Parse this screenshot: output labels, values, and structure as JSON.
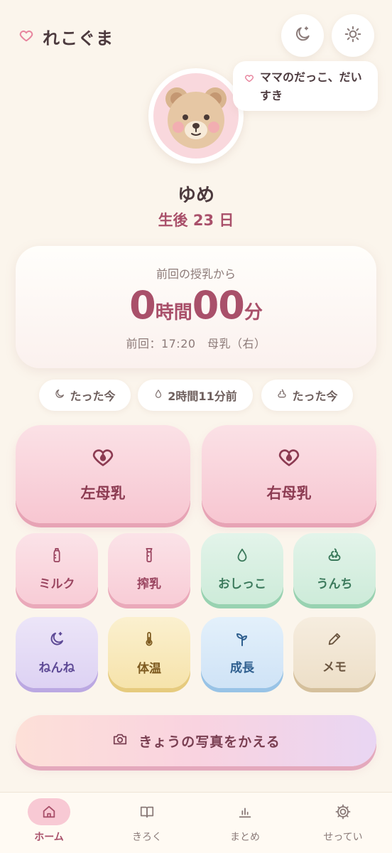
{
  "header": {
    "app_title": "れこぐま",
    "colors": {
      "brand": "#a9506a",
      "background": "#fbf5ec"
    }
  },
  "bubble": {
    "text": "ママのだっこ、だいすき"
  },
  "baby": {
    "name": "ゆめ",
    "age": "生後 23 日"
  },
  "timer": {
    "label": "前回の授乳から",
    "hours": "0",
    "hours_unit": "時間",
    "minutes": "00",
    "minutes_unit": "分",
    "last": "前回：17:20　母乳（右）"
  },
  "chips": [
    {
      "icon": "moon-icon",
      "label": "たった今"
    },
    {
      "icon": "drop-icon",
      "label": "2時間11分前"
    },
    {
      "icon": "poop-icon",
      "label": "たった今"
    }
  ],
  "big_buttons": [
    {
      "icon": "heart-drop-icon",
      "label": "左母乳"
    },
    {
      "icon": "heart-drop-icon",
      "label": "右母乳"
    }
  ],
  "grid": [
    {
      "icon": "bottle-icon",
      "label": "ミルク",
      "color": "pink"
    },
    {
      "icon": "pump-icon",
      "label": "搾乳",
      "color": "pink"
    },
    {
      "icon": "drop-icon",
      "label": "おしっこ",
      "color": "green"
    },
    {
      "icon": "poop-icon",
      "label": "うんち",
      "color": "green"
    },
    {
      "icon": "moon-star-icon",
      "label": "ねんね",
      "color": "purple"
    },
    {
      "icon": "thermometer-icon",
      "label": "体温",
      "color": "yellow"
    },
    {
      "icon": "sprout-icon",
      "label": "成長",
      "color": "blue"
    },
    {
      "icon": "pencil-icon",
      "label": "メモ",
      "color": "beige"
    }
  ],
  "photo_button": {
    "icon": "camera-icon",
    "label": "きょうの写真をかえる"
  },
  "nav": [
    {
      "icon": "home-icon",
      "label": "ホーム",
      "active": true
    },
    {
      "icon": "book-icon",
      "label": "きろく",
      "active": false
    },
    {
      "icon": "chart-icon",
      "label": "まとめ",
      "active": false
    },
    {
      "icon": "gear-icon",
      "label": "せってい",
      "active": false
    }
  ]
}
